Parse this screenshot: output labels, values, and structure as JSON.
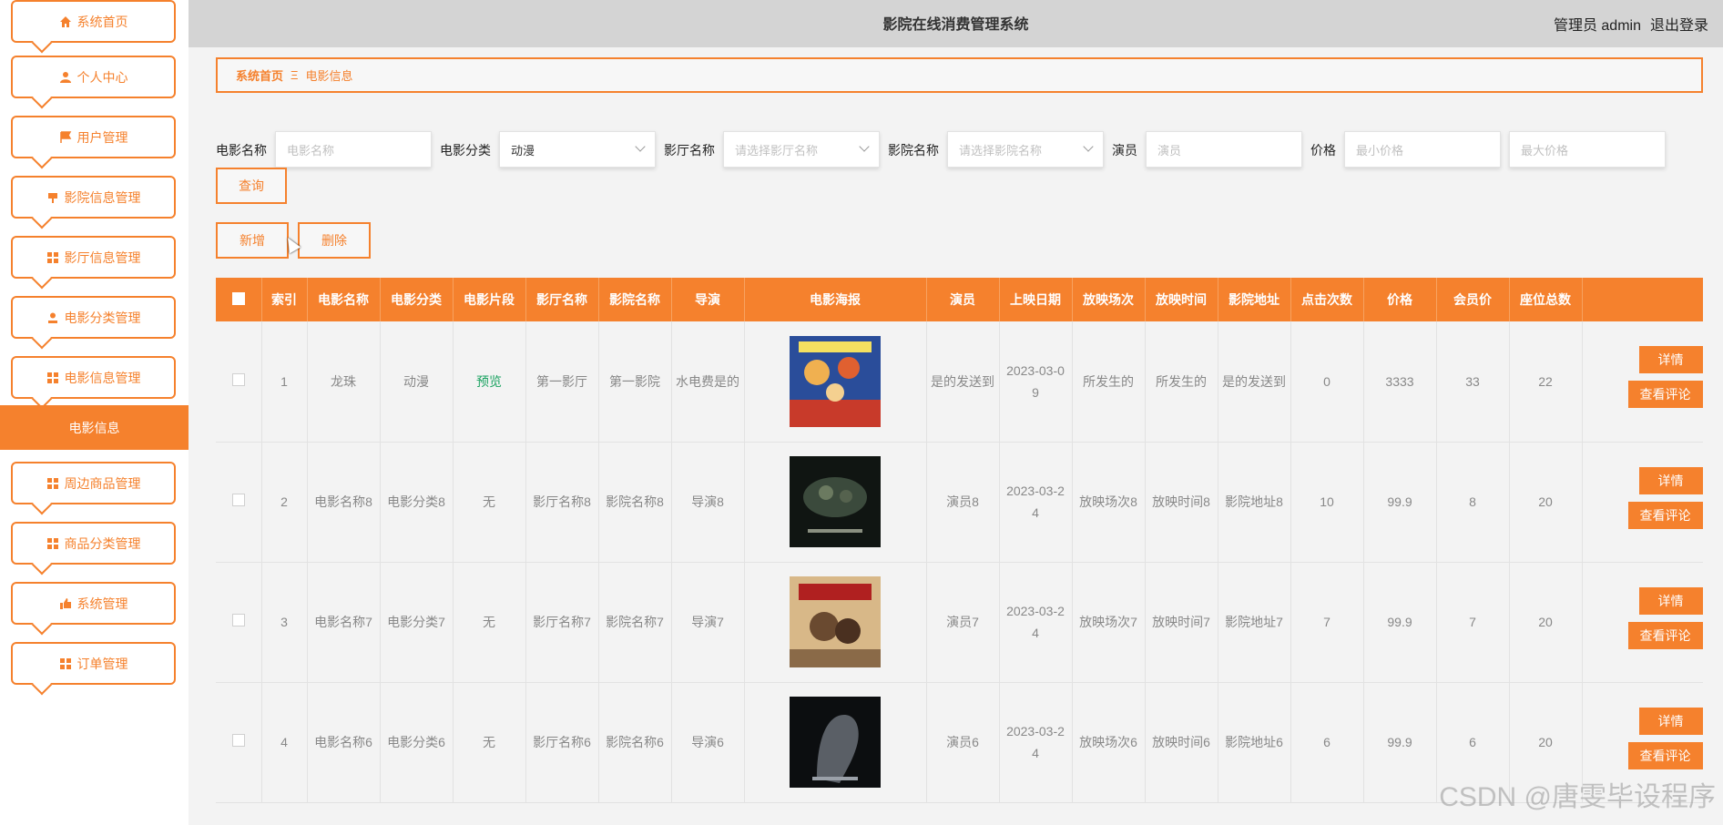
{
  "header": {
    "title": "影院在线消费管理系统",
    "user_label": "管理员 admin",
    "logout": "退出登录"
  },
  "sidebar": {
    "items": [
      {
        "label": "系统首页",
        "icon": "home-icon"
      },
      {
        "label": "个人中心",
        "icon": "person-icon"
      },
      {
        "label": "用户管理",
        "icon": "flag-icon"
      },
      {
        "label": "影院信息管理",
        "icon": "sign-icon"
      },
      {
        "label": "影厅信息管理",
        "icon": "grid-icon"
      },
      {
        "label": "电影分类管理",
        "icon": "user-icon"
      },
      {
        "label": "电影信息管理",
        "icon": "grid-icon"
      },
      {
        "label": "周边商品管理",
        "icon": "grid-icon"
      },
      {
        "label": "商品分类管理",
        "icon": "grid-icon"
      },
      {
        "label": "系统管理",
        "icon": "thumb-icon"
      },
      {
        "label": "订单管理",
        "icon": "grid-icon"
      }
    ],
    "active": "电影信息",
    "accent": "#f5812d"
  },
  "breadcrumb": {
    "home": "系统首页",
    "separator": "Ξ",
    "current": "电影信息"
  },
  "search": {
    "movie_name_label": "电影名称",
    "movie_name_placeholder": "电影名称",
    "category_label": "电影分类",
    "category_value": "动漫",
    "hall_label": "影厅名称",
    "hall_placeholder": "请选择影厅名称",
    "cinema_label": "影院名称",
    "cinema_placeholder": "请选择影院名称",
    "actor_label": "演员",
    "actor_placeholder": "演员",
    "price_label": "价格",
    "min_price_placeholder": "最小价格",
    "max_price_placeholder": "最大价格",
    "query_button": "查询"
  },
  "toolbar": {
    "add": "新增",
    "delete": "删除"
  },
  "table": {
    "columns": [
      "索引",
      "电影名称",
      "电影分类",
      "电影片段",
      "影厅名称",
      "影院名称",
      "导演",
      "电影海报",
      "演员",
      "上映日期",
      "放映场次",
      "放映时间",
      "影院地址",
      "点击次数",
      "价格",
      "会员价",
      "座位总数"
    ],
    "detail_label": "详情",
    "comment_label": "查看评论",
    "rows": [
      {
        "index": "1",
        "name": "龙珠",
        "category": "动漫",
        "clip": "预览",
        "hall": "第一影厅",
        "cinema": "第一影院",
        "director": "水电费是的",
        "actor": "是的发送到",
        "date": "2023-03-09",
        "session": "所发生的",
        "time": "所发生的",
        "address": "是的发送到",
        "clicks": "0",
        "price": "3333",
        "member_price": "33",
        "seats": "22"
      },
      {
        "index": "2",
        "name": "电影名称8",
        "category": "电影分类8",
        "clip": "无",
        "hall": "影厅名称8",
        "cinema": "影院名称8",
        "director": "导演8",
        "actor": "演员8",
        "date": "2023-03-24",
        "session": "放映场次8",
        "time": "放映时间8",
        "address": "影院地址8",
        "clicks": "10",
        "price": "99.9",
        "member_price": "8",
        "seats": "20"
      },
      {
        "index": "3",
        "name": "电影名称7",
        "category": "电影分类7",
        "clip": "无",
        "hall": "影厅名称7",
        "cinema": "影院名称7",
        "director": "导演7",
        "actor": "演员7",
        "date": "2023-03-24",
        "session": "放映场次7",
        "time": "放映时间7",
        "address": "影院地址7",
        "clicks": "7",
        "price": "99.9",
        "member_price": "7",
        "seats": "20"
      },
      {
        "index": "4",
        "name": "电影名称6",
        "category": "电影分类6",
        "clip": "无",
        "hall": "影厅名称6",
        "cinema": "影院名称6",
        "director": "导演6",
        "actor": "演员6",
        "date": "2023-03-24",
        "session": "放映场次6",
        "time": "放映时间6",
        "address": "影院地址6",
        "clicks": "6",
        "price": "99.9",
        "member_price": "6",
        "seats": "20"
      }
    ]
  },
  "watermark": "CSDN @唐雯毕设程序"
}
